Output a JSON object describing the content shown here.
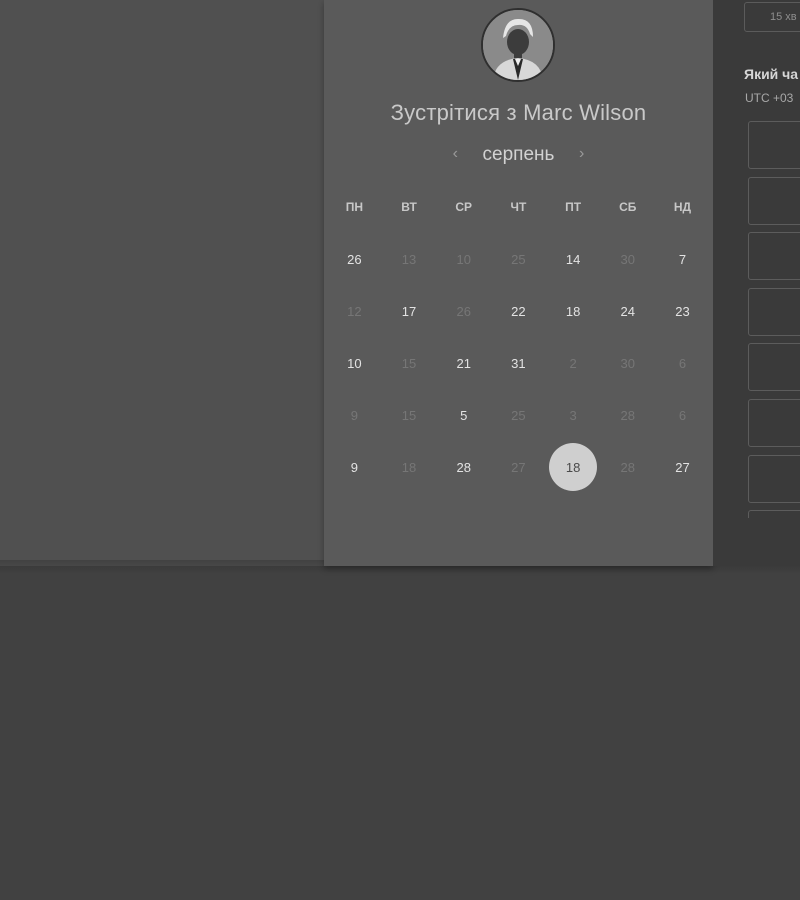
{
  "scheduler": {
    "title": "Зустрітися з Marc Wilson",
    "month": "серпень",
    "prev_icon": "chevron-left-icon",
    "next_icon": "chevron-right-icon",
    "weekdays": [
      "ПН",
      "ВТ",
      "СР",
      "ЧТ",
      "ПТ",
      "СБ",
      "НД"
    ],
    "weeks": [
      [
        {
          "d": "26",
          "a": true
        },
        {
          "d": "13",
          "a": false
        },
        {
          "d": "10",
          "a": false
        },
        {
          "d": "25",
          "a": false
        },
        {
          "d": "14",
          "a": true
        },
        {
          "d": "30",
          "a": false
        },
        {
          "d": "7",
          "a": true
        }
      ],
      [
        {
          "d": "12",
          "a": false
        },
        {
          "d": "17",
          "a": true
        },
        {
          "d": "26",
          "a": false
        },
        {
          "d": "22",
          "a": true
        },
        {
          "d": "18",
          "a": true
        },
        {
          "d": "24",
          "a": true
        },
        {
          "d": "23",
          "a": true
        }
      ],
      [
        {
          "d": "10",
          "a": true
        },
        {
          "d": "15",
          "a": false
        },
        {
          "d": "21",
          "a": true
        },
        {
          "d": "31",
          "a": true
        },
        {
          "d": "2",
          "a": false
        },
        {
          "d": "30",
          "a": false
        },
        {
          "d": "6",
          "a": false
        }
      ],
      [
        {
          "d": "9",
          "a": false
        },
        {
          "d": "15",
          "a": false
        },
        {
          "d": "5",
          "a": true
        },
        {
          "d": "25",
          "a": false
        },
        {
          "d": "3",
          "a": false
        },
        {
          "d": "28",
          "a": false
        },
        {
          "d": "6",
          "a": false
        }
      ],
      [
        {
          "d": "9",
          "a": true
        },
        {
          "d": "18",
          "a": false
        },
        {
          "d": "28",
          "a": true
        },
        {
          "d": "27",
          "a": false
        },
        {
          "d": "18",
          "a": true,
          "selected": true
        },
        {
          "d": "28",
          "a": false
        },
        {
          "d": "27",
          "a": true
        }
      ]
    ]
  },
  "time_panel": {
    "duration": "15 хв",
    "question": "Який ча",
    "timezone": "UTC +03",
    "slot_count": 8
  },
  "colors": {
    "page_bg": "#414141",
    "card_bg": "#5a5a5a",
    "selected_day_bg": "#cfcfcf"
  }
}
